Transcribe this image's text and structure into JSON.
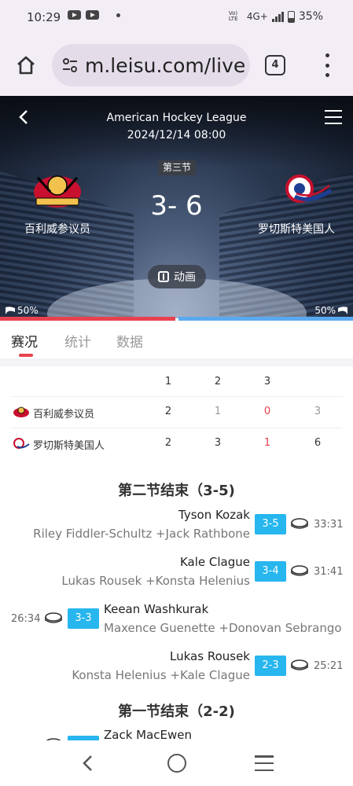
{
  "status_bar": {
    "time": "10:29",
    "network": "4G+",
    "volte": "Vo) LTE",
    "battery": "35%",
    "icons": [
      "youtube-icon",
      "youtube-icon",
      "dot-icon",
      "signal-icon",
      "battery-icon"
    ]
  },
  "browser": {
    "url": "m.leisu.com/live",
    "tab_count": "4"
  },
  "match": {
    "league": "American Hockey League",
    "datetime": "2024/12/14 08:00",
    "period": "第三节",
    "score": "3- 6",
    "home_team": "百利威参议员",
    "away_team": "罗切斯特美国人",
    "animation_label": "动画",
    "home_pct": "50%",
    "away_pct": "50%",
    "possession_home": 0.5
  },
  "tabs": [
    {
      "label": "赛况",
      "active": true
    },
    {
      "label": "统计",
      "active": false
    },
    {
      "label": "数据",
      "active": false
    }
  ],
  "score_table": {
    "headers": [
      "1",
      "2",
      "3"
    ],
    "rows": [
      {
        "team": "百利威参议员",
        "p1": "2",
        "p2": "1",
        "p3": "0",
        "total": "3"
      },
      {
        "team": "罗切斯特美国人",
        "p1": "2",
        "p2": "3",
        "p3": "1",
        "total": "6"
      }
    ]
  },
  "timeline": {
    "section1": "第二节结束（3-5)",
    "events": [
      {
        "player": "Tyson Kozak",
        "assist": "Riley Fiddler-Schultz +Jack Rathbone",
        "score": "3-5",
        "time": "33:31",
        "side": "away"
      },
      {
        "player": "Kale Clague",
        "assist": "Lukas Rousek +Konsta Helenius",
        "score": "3-4",
        "time": "31:41",
        "side": "away"
      },
      {
        "player": "Keean Washkurak",
        "assist": "Maxence Guenette +Donovan Sebrango",
        "score": "3-3",
        "time": "26:34",
        "side": "home"
      },
      {
        "player": "Lukas Rousek",
        "assist": "Konsta Helenius +Kale Clague",
        "score": "2-3",
        "time": "25:21",
        "side": "away"
      }
    ],
    "section2": "第一节结束（2-2)",
    "partial_event": {
      "player": "Zack MacEwen"
    }
  },
  "colors": {
    "accent_red": "#e8414f",
    "accent_blue": "#5aa9f0",
    "badge_blue": "#27b6ee"
  }
}
